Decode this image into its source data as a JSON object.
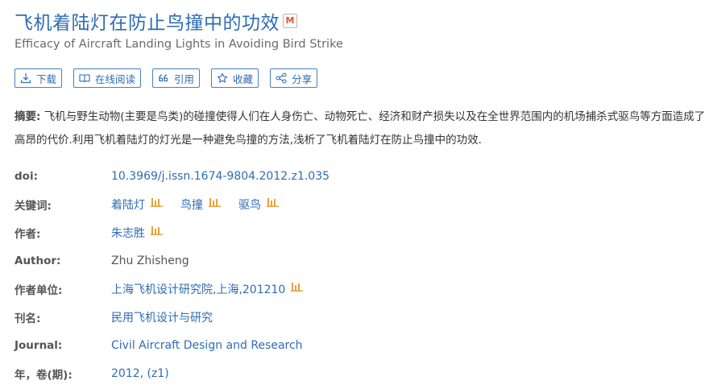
{
  "title": "飞机着陆灯在防止鸟撞中的功效",
  "title_badge": "M",
  "subtitle": "Efficacy of Aircraft Landing Lights in Avoiding Bird Strike",
  "toolbar": [
    {
      "label": "下载",
      "icon": "download-icon"
    },
    {
      "label": "在线阅读",
      "icon": "book-icon"
    },
    {
      "label": "引用",
      "icon": "quote-icon"
    },
    {
      "label": "收藏",
      "icon": "star-icon"
    },
    {
      "label": "分享",
      "icon": "share-icon"
    }
  ],
  "abstract": {
    "label": "摘要:",
    "text": "飞机与野生动物(主要是鸟类)的碰撞使得人们在人身伤亡、动物死亡、经济和财产损失以及在全世界范围内的机场捕杀式驱鸟等方面造成了高昂的代价.利用飞机着陆灯的灯光是一种避免鸟撞的方法,浅析了飞机着陆灯在防止鸟撞中的功效."
  },
  "meta": {
    "doi": {
      "label": "doi:",
      "value": "10.3969/j.issn.1674-9804.2012.z1.035"
    },
    "keywords": {
      "label": "关键词:",
      "items": [
        "着陆灯",
        "鸟撞",
        "驱鸟"
      ]
    },
    "author_cn": {
      "label": "作者:",
      "value": "朱志胜"
    },
    "author_en": {
      "label": "Author:",
      "value": "Zhu Zhisheng"
    },
    "affiliation": {
      "label": "作者单位:",
      "value": "上海飞机设计研究院,上海,201210"
    },
    "journal_cn": {
      "label": "刊名:",
      "value": "民用飞机设计与研究"
    },
    "journal_en": {
      "label": "Journal:",
      "value": "Civil Aircraft Design and Research"
    },
    "year": {
      "label": "年，卷(期):",
      "value": "2012, (z1)"
    }
  },
  "colors": {
    "link": "#2e6cb5",
    "chart_icon": "#e8a13a",
    "border": "#4a7fc1"
  }
}
